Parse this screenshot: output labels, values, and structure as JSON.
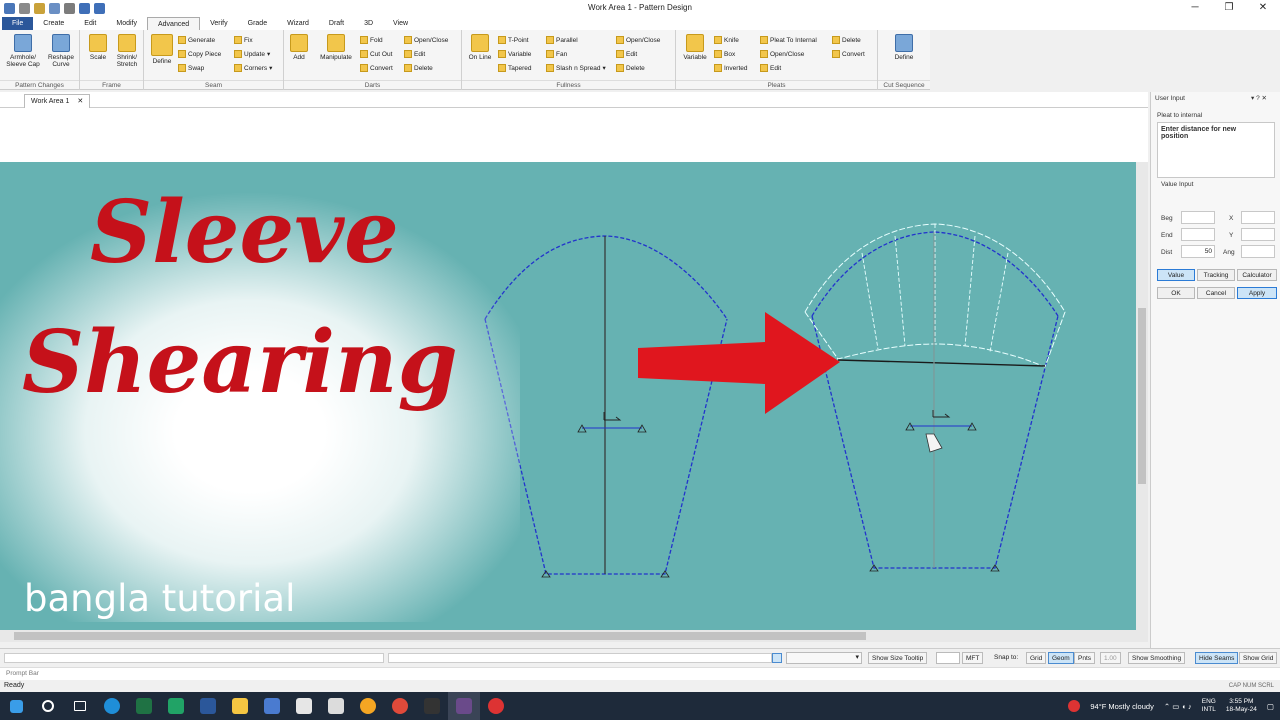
{
  "window": {
    "title": "Work Area 1 - Pattern Design",
    "minimize": "─",
    "maximize": "❐",
    "close": "✕"
  },
  "menu": {
    "tabs": [
      "File",
      "Create",
      "Edit",
      "Modify",
      "Advanced",
      "Verify",
      "Grade",
      "Wizard",
      "Draft",
      "3D",
      "View"
    ],
    "active": "Advanced"
  },
  "ribbon": {
    "groups": {
      "pattern_changes": "Pattern Changes",
      "frame": "Frame",
      "seam": "Seam",
      "darts": "Darts",
      "fullness": "Fullness",
      "pleats": "Pleats",
      "cut_sequence": "Cut Sequence"
    },
    "armhole": "Armhole/ Sleeve Cap",
    "reshape": "Reshape Curve",
    "scale": "Scale",
    "shrink": "Shrink/ Stretch",
    "seam_define": "Define",
    "generate": "Generate",
    "copy_piece": "Copy Piece",
    "swap": "Swap",
    "fix": "Fix",
    "update": "Update",
    "corners": "Corners",
    "add": "Add",
    "manipulate": "Manipulate",
    "fold": "Fold",
    "cut_out": "Cut Out",
    "convert": "Convert",
    "open_close": "Open/Close",
    "edit": "Edit",
    "delete": "Delete",
    "on_line": "On Line",
    "t_point": "T-Point",
    "variable": "Variable",
    "tapered": "Tapered",
    "parallel": "Parallel",
    "fan": "Fan",
    "slash_spread": "Slash n Spread",
    "open_close2": "Open/Close",
    "edit2": "Edit",
    "delete2": "Delete",
    "pleat_variable": "Variable",
    "knife": "Knife",
    "box": "Box",
    "inverted": "Inverted",
    "pleat_to_internal": "Pleat To Internal",
    "open_close3": "Open/Close",
    "edit3": "Edit",
    "delete3": "Delete",
    "convert3": "Convert",
    "cut_define": "Define"
  },
  "doc_tab": {
    "label": "Work Area 1",
    "close": "✕"
  },
  "overlay": {
    "title_line1": "Sleeve",
    "title_line2": "Shearing",
    "subtitle": "bangla tutorial"
  },
  "user_input": {
    "header": "User Input",
    "command": "Pleat to internal",
    "prompt": "Enter distance for new position",
    "value_input": "Value Input",
    "beg": "Beg",
    "end": "End",
    "dist": "Dist",
    "dist_value": "50",
    "x": "X",
    "y": "Y",
    "ang": "Ang",
    "btn_value": "Value",
    "btn_tracking": "Tracking",
    "btn_calculator": "Calculator",
    "ok": "OK",
    "cancel": "Cancel",
    "apply": "Apply"
  },
  "status": {
    "show_size_tooltip": "Show Size Tooltip",
    "mft": "MFT",
    "snap_to": "Snap to:",
    "grid": "Grid",
    "geom": "Geom",
    "pnts": "Pnts",
    "value_field": "1.00",
    "show_smoothing": "Show Smoothing",
    "hide_seams": "Hide Seams",
    "show_grid": "Show Grid"
  },
  "prompt_bar": "Prompt Bar",
  "ready": "Ready",
  "indicators": "CAP NUM SCRL",
  "taskbar": {
    "weather": "94°F  Mostly cloudy",
    "lang1": "ENG",
    "lang2": "INTL",
    "time": "3:55 PM",
    "date": "18-May-24"
  },
  "colors": {
    "canvas": "#66b2b2",
    "title_red": "#c5111a",
    "pattern_blue": "#2233cc",
    "arrow_red": "#e0161e"
  }
}
